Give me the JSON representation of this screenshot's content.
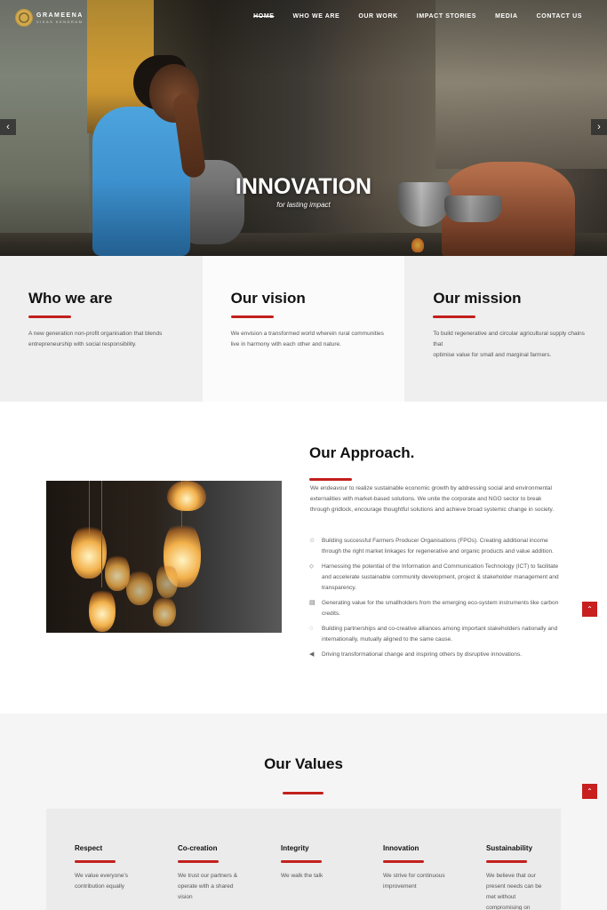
{
  "header": {
    "logo_name": "GRAMEENA",
    "logo_sub": "VIKAS KENDRAM",
    "nav": [
      "HOME",
      "WHO WE ARE",
      "OUR WORK",
      "IMPACT STORIES",
      "MEDIA",
      "CONTACT US"
    ]
  },
  "hero": {
    "title": "INNOVATION",
    "subtitle": "for lasting impact",
    "prev_icon": "‹",
    "next_icon": "›"
  },
  "cards": [
    {
      "title": "Who we are",
      "text": "A new generation non-profit organisation that blends entrepreneurship with social responsibility."
    },
    {
      "title": "Our vision",
      "text": "We envision a transformed world wherein rural communities live in harmony with each other and nature."
    },
    {
      "title": "Our mission",
      "text": "To build regenerative and circular agricultural supply chains that",
      "text2": "optimise value for small and marginal farmers."
    }
  ],
  "approach": {
    "title": "Our Approach.",
    "intro": "We endeavour to realize sustainable economic growth by addressing social and environmental externalities with market-based solutions. We unite the corporate and NGO sector to break through gridlock, encourage thoughtful solutions and achieve broad systemic change in society.",
    "items": [
      {
        "icon": "☆",
        "text": "Building successful Farmers Producer Organisations (FPOs). Creating additional income through the right market linkages for regenerative and organic products and value addition."
      },
      {
        "icon": "⬦",
        "text": "Harnessing the potential of the Information and Communication Technology (ICT) to facilitate and accelerate sustainable community development, project & stakeholder management and transparency."
      },
      {
        "icon": "▤",
        "text": "Generating value for the smallholders from the emerging eco-system instruments like carbon credits."
      },
      {
        "icon": "◌",
        "text": "Building partnerships and co-creative alliances among important stakeholders nationally and internationally, mutually aligned to the same cause."
      },
      {
        "icon": "◀",
        "text": "Driving transformational change and inspiring others by disruptive innovations."
      }
    ]
  },
  "scroll_top_icon": "⌃",
  "values": {
    "title": "Our Values",
    "items": [
      {
        "name": "Respect",
        "text": "We value everyone's contribution equally"
      },
      {
        "name": "Co-creation",
        "text": "We trust our partners & operate with a shared vision"
      },
      {
        "name": "Integrity",
        "text": "We walk the talk"
      },
      {
        "name": "Innovation",
        "text": "We strive for continuous improvement"
      },
      {
        "name": "Sustainability",
        "text": "We believe that our present needs can be met without compromising on"
      }
    ]
  },
  "colors": {
    "accent": "#c2201c",
    "scroll_top": "#c81f1f"
  }
}
